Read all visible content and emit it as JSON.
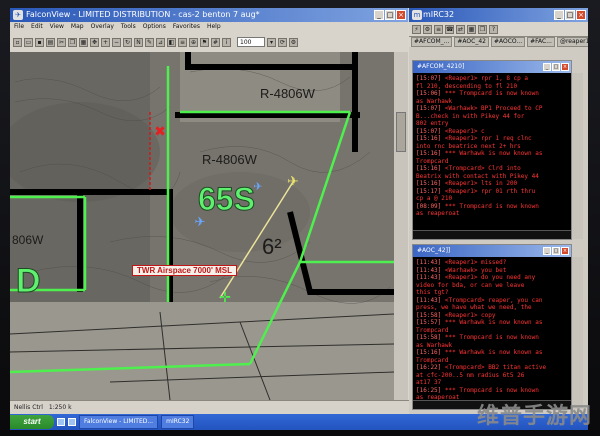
{
  "falconview": {
    "title": "FalconView - LIMITED DISTRIBUTION - cas-2 benton 7 aug*",
    "menu": [
      "File",
      "Edit",
      "View",
      "Map",
      "Overlay",
      "Tools",
      "Options",
      "Favorites",
      "Help"
    ],
    "scale_value": "100",
    "map": {
      "airspace_labels": [
        "R-4806W",
        "R-4806W",
        "806W"
      ],
      "zone_label": "65S",
      "altitude_label": "6²",
      "zone_letter": "D",
      "airspace_tag": "TWR Airspace 7000' MSL"
    },
    "status": [
      "Nellis Ctrl",
      "1:250 k"
    ]
  },
  "mirc": {
    "title": "mIRC32",
    "tabs": [
      "#AFCOM_...",
      "#AOC_42",
      "#AOCO...",
      "#FAC...",
      "@reaper1"
    ],
    "window1": {
      "title": "#AFCOM_4210]",
      "lines": [
        {
          "ts": "[15:07]",
          "text": "<Reaper1> rpr 1, 8 cp a"
        },
        {
          "ts": "",
          "text": "  fl 210, descending to fl 210"
        },
        {
          "ts": "[15:06]",
          "text": "*** Trompcard is now known"
        },
        {
          "ts": "",
          "text": "as Warhawk"
        },
        {
          "ts": "[15:07]",
          "text": "<Warhawk> BP1 Proceed to CP"
        },
        {
          "ts": "",
          "text": "  B...check in with Pikey 44 for"
        },
        {
          "ts": "",
          "text": "  802 entry"
        },
        {
          "ts": "[15:07]",
          "text": "<Reaper1> c"
        },
        {
          "ts": "[15:16]",
          "text": "<Reaper1> rpr 1 req clnc"
        },
        {
          "ts": "",
          "text": "  into rnc beatrice next 2+ hrs"
        },
        {
          "ts": "[15:16]",
          "text": "*** Warhawk is now known as"
        },
        {
          "ts": "",
          "text": "Trompcard"
        },
        {
          "ts": "[15:16]",
          "text": "<Trompcard> Clrd into"
        },
        {
          "ts": "",
          "text": "  Beatrix with contact with Pikey 44"
        },
        {
          "ts": "[15:16]",
          "text": "<Reaper1> lts in 200"
        },
        {
          "ts": "[15:17]",
          "text": "<Reaper1> rpr 01 rth thru"
        },
        {
          "ts": "",
          "text": "  cp a @ 210"
        },
        {
          "ts": "[08:09]",
          "text": "*** Trompcard is now known"
        },
        {
          "ts": "",
          "text": "as reaperoat"
        }
      ]
    },
    "window2": {
      "title": "#AOC_42]]",
      "lines": [
        {
          "ts": "[11:43]",
          "text": "<Reaper1> missed?"
        },
        {
          "ts": "[11:43]",
          "text": "<Warhawk> you bet"
        },
        {
          "ts": "[11:43]",
          "text": "<Reaper1> do you need any"
        },
        {
          "ts": "",
          "text": "  video for bda, or can we leave"
        },
        {
          "ts": "",
          "text": "  this tgt?"
        },
        {
          "ts": "[11:43]",
          "text": "<Trompcard> reaper, you can"
        },
        {
          "ts": "",
          "text": "  press, we have what we need, the"
        },
        {
          "ts": "[15:58]",
          "text": "<Reaper1> copy"
        },
        {
          "ts": "[15:57]",
          "text": "*** Warhawk is now known as"
        },
        {
          "ts": "",
          "text": "Trompcard"
        },
        {
          "ts": "[15:58]",
          "text": "*** Trompcard is now known"
        },
        {
          "ts": "",
          "text": "as Warhawk"
        },
        {
          "ts": "[15:16]",
          "text": "*** Warhawk is now known as"
        },
        {
          "ts": "",
          "text": "Trompcard"
        },
        {
          "ts": "[16:22]",
          "text": "<Trompcard> BB2 titan active"
        },
        {
          "ts": "",
          "text": "  at cfc-200..5 nm radius 6t5 26"
        },
        {
          "ts": "",
          "text": "  at17 37"
        },
        {
          "ts": "[16:25]",
          "text": "*** Trompcard is now known"
        },
        {
          "ts": "",
          "text": "as reaperoat"
        }
      ]
    }
  },
  "taskbar": {
    "start_label": "start",
    "items": [
      "FalconView - LIMITED...",
      "mIRC32"
    ]
  },
  "watermark": "维普手游网"
}
